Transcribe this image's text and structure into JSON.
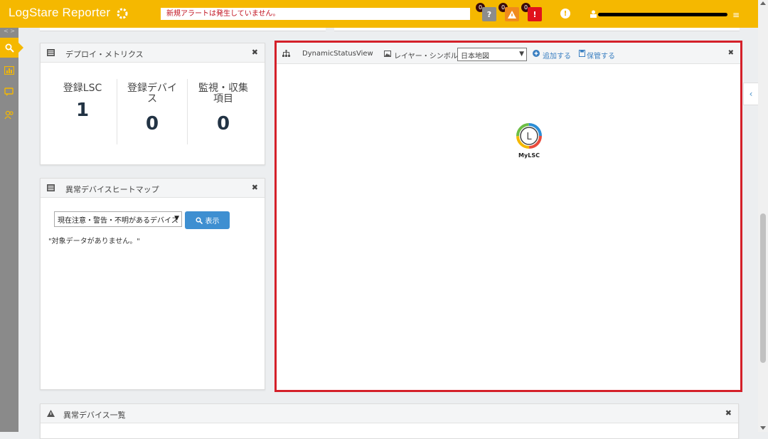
{
  "header": {
    "app_title": "LogStare Reporter",
    "alert_message": "新規アラートは発生していません。",
    "badges": [
      {
        "count": "0",
        "symbol": "?",
        "color": "#8c8c8c"
      },
      {
        "count": "0",
        "symbol": "!",
        "color": "#f08a1c"
      },
      {
        "count": "0",
        "symbol": "!",
        "color": "#e0121c"
      }
    ],
    "info_symbol": "!",
    "menu_symbol": "≡"
  },
  "sidebar": {
    "arrows": "< >",
    "items": [
      {
        "icon": "search-icon",
        "active": true
      },
      {
        "icon": "report-icon",
        "active": false
      },
      {
        "icon": "chat-icon",
        "active": false
      },
      {
        "icon": "users-icon",
        "active": false
      }
    ]
  },
  "deploy_metrics": {
    "title": "デプロイ・メトリクス",
    "close": "✖",
    "metrics": [
      {
        "label": "登録LSC",
        "value": "1"
      },
      {
        "label": "登録デバイス",
        "value": "0"
      },
      {
        "label": "監視・収集項目",
        "value": "0"
      }
    ]
  },
  "heatmap": {
    "title": "異常デバイスヒートマップ",
    "close": "✖",
    "filter_selected": "現在注意・警告・不明があるデバイス",
    "show_button": "表示",
    "no_data": "\"対象データがありません。\""
  },
  "dynamic_view": {
    "title": "DynamicStatusView",
    "layer_label": "レイヤー・シンボル",
    "layer_selected": "日本地図",
    "add_link": "追加する",
    "save_link": "保管する",
    "close": "✖",
    "node_name": "MyLSC",
    "node_letter": "L"
  },
  "abnormal_list": {
    "title": "異常デバイス一覧",
    "close": "✖"
  },
  "collapse_symbol": "‹",
  "colors": {
    "header": "#f5b800",
    "sidebar": "#8a8a8a",
    "highlight_border": "#d4202a",
    "button_blue": "#3e8fd1"
  }
}
